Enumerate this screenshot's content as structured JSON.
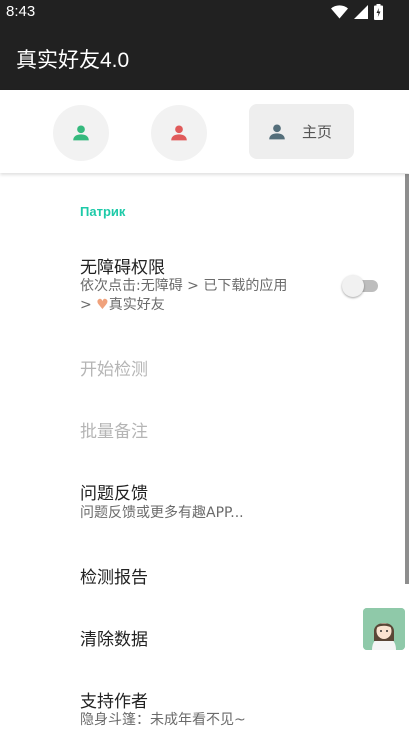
{
  "status_bar": {
    "time": "8:43"
  },
  "app_bar": {
    "title": "真实好友4.0"
  },
  "tabs": {
    "home_label": "主页"
  },
  "colors": {
    "accent": "#1dcaa8",
    "tab_green": "#35b97d",
    "tab_red": "#e05a5a",
    "tab_home_icon": "#546e7a",
    "heart": "#f0a27c"
  },
  "settings": {
    "category": "Патрик",
    "accessibility": {
      "title": "无障碍权限",
      "summary_line1": "依次点击:无障碍 > 已下载的应用",
      "summary_prefix": ">",
      "summary_suffix": "真实好友",
      "enabled": false
    },
    "start_detection": {
      "title": "开始检测"
    },
    "batch_note": {
      "title": "批量备注"
    },
    "feedback": {
      "title": "问题反馈",
      "summary": "问题反馈或更多有趣APP..."
    },
    "report": {
      "title": "检测报告"
    },
    "clear_data": {
      "title": "清除数据"
    },
    "support": {
      "title": "支持作者",
      "summary": "隐身斗篷：未成年看不见~"
    }
  }
}
